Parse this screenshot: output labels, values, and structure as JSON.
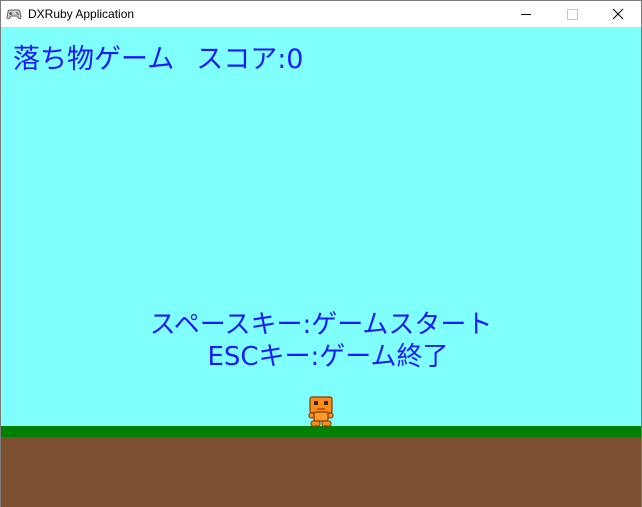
{
  "window": {
    "title": "DXRuby Application",
    "icons": {
      "app": "gamepad-icon",
      "minimize": "minimize-icon",
      "maximize": "maximize-icon",
      "close": "close-icon"
    }
  },
  "game": {
    "title_label": "落ち物ゲーム",
    "score_label": "スコア:0",
    "start_instruction": "スペースキー:ゲームスタート",
    "exit_instruction": "ESCキー:ゲーム終了",
    "player_sprite": "robot-character"
  },
  "colors": {
    "sky": "#80ffff",
    "text": "#1a1aff",
    "grass": "#008000",
    "ground": "#7a5030",
    "player": "#ff8c1a"
  }
}
